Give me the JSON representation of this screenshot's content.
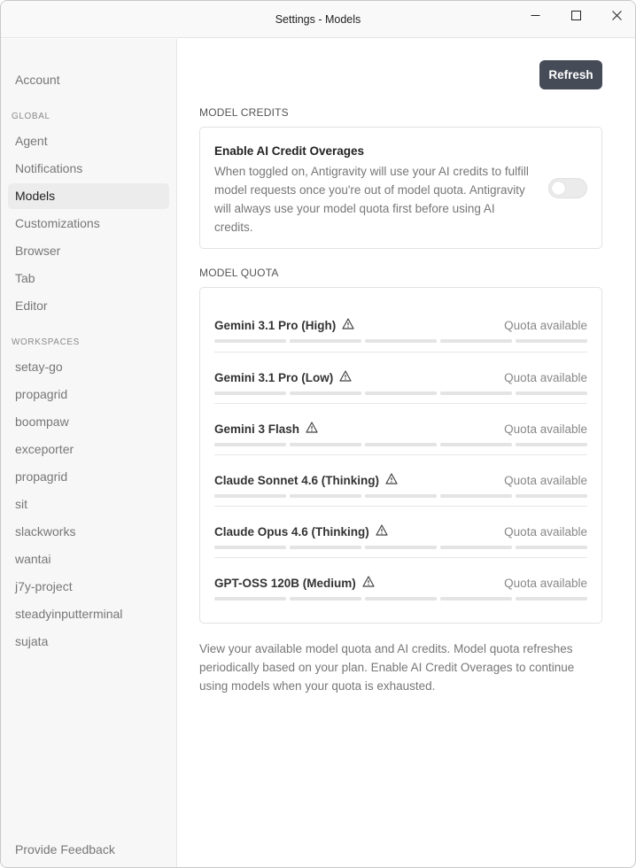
{
  "window": {
    "title": "Settings - Models"
  },
  "sidebar": {
    "account": "Account",
    "global_label": "GLOBAL",
    "global_items": [
      {
        "label": "Agent",
        "active": false
      },
      {
        "label": "Notifications",
        "active": false
      },
      {
        "label": "Models",
        "active": true
      },
      {
        "label": "Customizations",
        "active": false
      },
      {
        "label": "Browser",
        "active": false
      },
      {
        "label": "Tab",
        "active": false
      },
      {
        "label": "Editor",
        "active": false
      }
    ],
    "workspaces_label": "WORKSPACES",
    "workspaces": [
      "setay-go",
      "propagrid",
      "boompaw",
      "exceporter",
      "propagrid",
      "sit",
      "slackworks",
      "wantai",
      "j7y-project",
      "steadyinputterminal",
      "sujata"
    ],
    "feedback": "Provide Feedback"
  },
  "main": {
    "refresh_label": "Refresh",
    "credits": {
      "section_title": "MODEL CREDITS",
      "title": "Enable AI Credit Overages",
      "description": "When toggled on, Antigravity will use your AI credits to fulfill model requests once you're out of model quota. Antigravity will always use your model quota first before using AI credits.",
      "toggle_on": false
    },
    "quota": {
      "section_title": "MODEL QUOTA",
      "models": [
        {
          "name": "Gemini 3.1 Pro (High)",
          "status": "Quota available",
          "level": 1.0
        },
        {
          "name": "Gemini 3.1 Pro (Low)",
          "status": "Quota available",
          "level": 1.0
        },
        {
          "name": "Gemini 3 Flash",
          "status": "Quota available",
          "level": 1.0
        },
        {
          "name": "Claude Sonnet 4.6 (Thinking)",
          "status": "Quota available",
          "level": 1.0
        },
        {
          "name": "Claude Opus 4.6 (Thinking)",
          "status": "Quota available",
          "level": 1.0
        },
        {
          "name": "GPT-OSS 120B (Medium)",
          "status": "Quota available",
          "level": 1.0
        }
      ]
    },
    "footnote": "View your available model quota and AI credits. Model quota refreshes periodically based on your plan. Enable AI Credit Overages to continue using models when your quota is exhausted."
  },
  "colors": {
    "accent_button": "#454c58",
    "active_nav_bg": "#ececec",
    "bar_track": "#e4e4e4"
  },
  "icons": {
    "minimize": "minimize-icon",
    "maximize": "maximize-icon",
    "close": "close-icon",
    "warning": "warning-triangle-icon"
  }
}
